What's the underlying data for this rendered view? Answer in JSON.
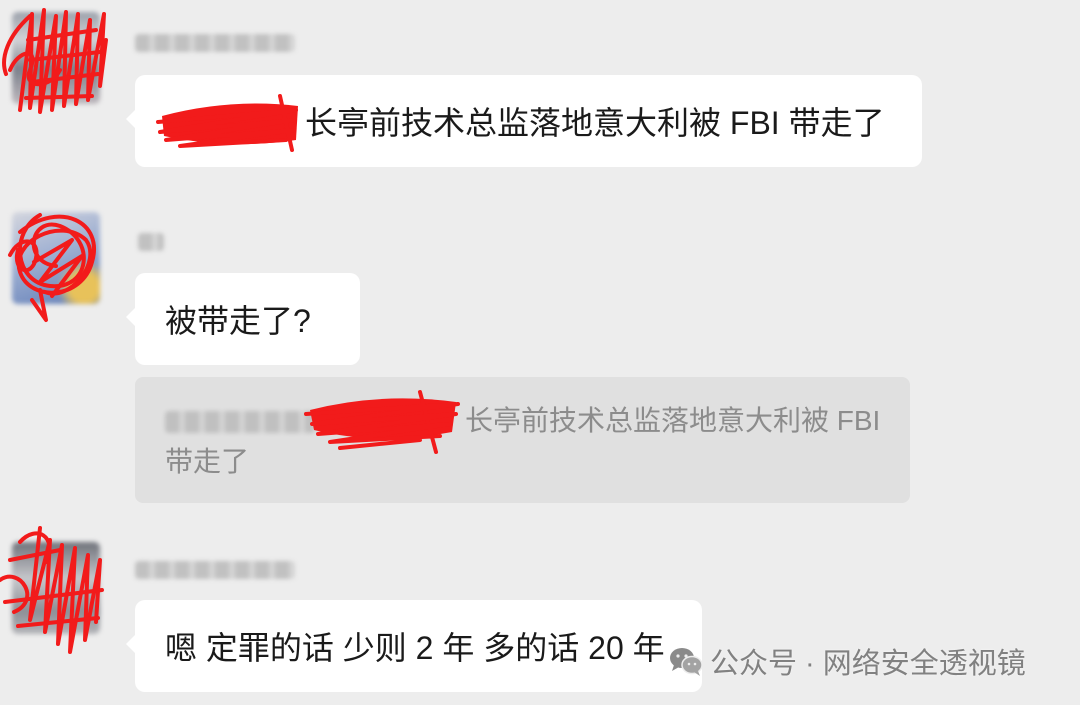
{
  "chat": {
    "messages": [
      {
        "id": "m1",
        "text": "长亭前技术总监落地意大利被 FBI 带走了"
      },
      {
        "id": "m2",
        "text": "被带走了?"
      },
      {
        "id": "m3",
        "text": "嗯 定罪的话 少则 2 年 多的话 20 年"
      }
    ],
    "quote": {
      "lines": [
        "长亭前技术总监落地意大利被 FBI",
        "带走了"
      ]
    }
  },
  "watermark": {
    "icon": "wechat-icon",
    "text": "公众号 · 网络安全透视镜"
  },
  "colors": {
    "background": "#ededed",
    "bubble": "#ffffff",
    "quote_background": "#e0e0e0",
    "text": "#1a1a1a",
    "quote_text": "#8c8c8c",
    "redaction": "#f21b1b"
  }
}
